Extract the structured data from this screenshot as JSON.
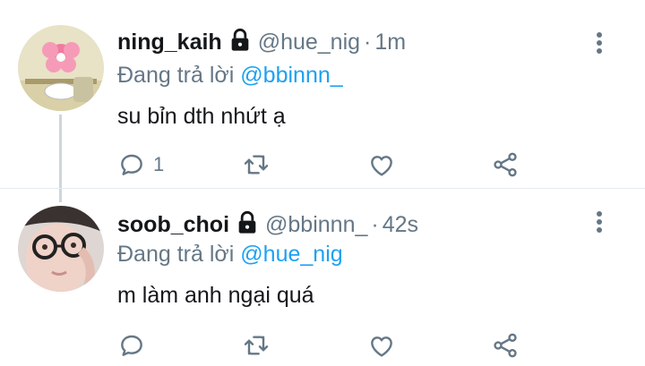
{
  "colors": {
    "accent": "#1da1f2",
    "secondary_text": "#657786",
    "primary_text": "#14171a",
    "divider": "#e6ecf0",
    "thread_line": "#ccd6dd"
  },
  "tweets": [
    {
      "display_name": "ning_kaih",
      "handle": "@hue_nig",
      "separator": "·",
      "time": "1m",
      "replying_prefix": "Đang trả lời",
      "replying_to": "@bbinnn_",
      "text": "su bỉn dth nhứt ạ",
      "reply_count": "1",
      "avatar_icon": "pink-flower-cartoon-avatar",
      "lock_icon": "lock-icon"
    },
    {
      "display_name": "soob_choi",
      "handle": "@bbinnn_",
      "separator": "·",
      "time": "42s",
      "replying_prefix": "Đang trả lời",
      "replying_to": "@hue_nig",
      "text": "m làm anh ngại quá",
      "reply_count": "",
      "avatar_icon": "person-glasses-photo-avatar",
      "lock_icon": "lock-icon"
    }
  ]
}
